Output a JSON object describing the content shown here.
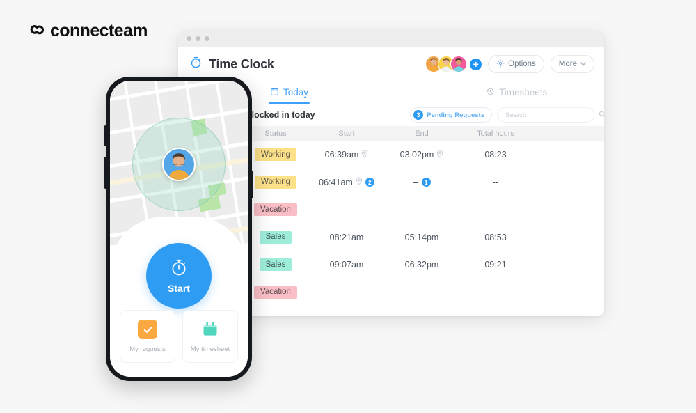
{
  "brand": {
    "name": "connecteam"
  },
  "browser": {
    "window_dots": [
      "dot-1",
      "dot-2",
      "dot-3"
    ]
  },
  "app": {
    "title": "Time Clock",
    "title_icon": "stopwatch-icon",
    "header": {
      "add_button_label": "+",
      "options_label": "Options",
      "options_icon": "gear-icon",
      "more_label": "More",
      "more_icon": "chevron-down-icon",
      "avatars": [
        {
          "name": "avatar-1",
          "bg": "#f0a24a"
        },
        {
          "name": "avatar-2",
          "bg": "#f7d24a"
        },
        {
          "name": "avatar-3",
          "bg": "#f05a9b"
        }
      ]
    },
    "tabs": [
      {
        "label": "Today",
        "icon": "calendar-icon",
        "active": true
      },
      {
        "label": "Timesheets",
        "icon": "history-icon",
        "active": false
      }
    ],
    "toolbar": {
      "title": "All users that clocked in today",
      "pending_count": "3",
      "pending_label": "Pending Requests",
      "search_placeholder": "Search",
      "search_value": "",
      "search_icon": "search-icon"
    },
    "table": {
      "columns": [
        "",
        "Status",
        "Start",
        "End",
        "Total hours"
      ],
      "rows": [
        {
          "avatar": "avatar-row-1",
          "avatar_bg": "#d8d8d8",
          "status": "Working",
          "status_type": "working",
          "start": "06:39am",
          "start_pin": true,
          "start_count": "",
          "end": "03:02pm",
          "end_pin": true,
          "end_count": "",
          "total": "08:23"
        },
        {
          "avatar": "avatar-row-2",
          "avatar_bg": "#4a9fe0",
          "status": "Working",
          "status_type": "working",
          "start": "06:41am",
          "start_pin": true,
          "start_count": "2",
          "end": "--",
          "end_pin": false,
          "end_count": "1",
          "total": "--"
        },
        {
          "avatar": "avatar-row-3",
          "avatar_bg": "#dedede",
          "status": "Vacation",
          "status_type": "vacation",
          "start": "--",
          "start_pin": false,
          "start_count": "",
          "end": "--",
          "end_pin": false,
          "end_count": "",
          "total": "--"
        },
        {
          "avatar": "avatar-row-4",
          "avatar_bg": "#d9d6f2",
          "status": "Sales",
          "status_type": "sales",
          "start": "08:21am",
          "start_pin": false,
          "start_count": "",
          "end": "05:14pm",
          "end_pin": false,
          "end_count": "",
          "total": "08:53"
        },
        {
          "avatar": "avatar-row-5",
          "avatar_bg": "#86cdd4",
          "status": "Sales",
          "status_type": "sales",
          "start": "09:07am",
          "start_pin": false,
          "start_count": "",
          "end": "06:32pm",
          "end_pin": false,
          "end_count": "",
          "total": "09:21"
        },
        {
          "avatar": "avatar-row-6",
          "avatar_bg": "#f0e2d2",
          "status": "Vacation",
          "status_type": "vacation",
          "start": "--",
          "start_pin": false,
          "start_count": "",
          "end": "--",
          "end_pin": false,
          "end_count": "",
          "total": "--"
        }
      ]
    }
  },
  "phone": {
    "map": {
      "geofence": "geofence-circle",
      "marker": "user-location-marker"
    },
    "start_button": {
      "label": "Start",
      "icon": "stopwatch-icon"
    },
    "quick_actions": [
      {
        "label": "My requests",
        "icon": "checkbox-icon",
        "color": "#f9a93f"
      },
      {
        "label": "My timesheet",
        "icon": "calendar-icon",
        "color": "#4fd6bd"
      }
    ]
  },
  "colors": {
    "accent_blue": "#2f9cf4",
    "status_working": "#fce189",
    "status_vacation": "#fabec6",
    "status_sales": "#9eeddb"
  }
}
